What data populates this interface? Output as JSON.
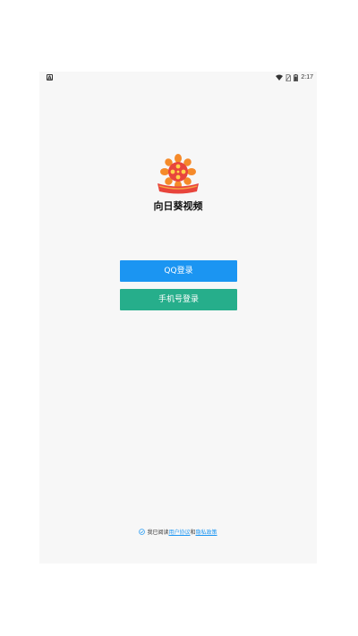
{
  "status_bar": {
    "notification_icon": "A",
    "time": "2:17",
    "icons": [
      "wifi-icon",
      "no-sim-icon",
      "battery-icon"
    ]
  },
  "app": {
    "name": "向日葵视频",
    "logo_icon": "sunflower-logo-icon"
  },
  "buttons": {
    "qq_login": "QQ登录",
    "phone_login": "手机号登录"
  },
  "agreement": {
    "prefix": "我已阅读",
    "user_agreement": "用户协议",
    "and": "和",
    "privacy_policy": "隐私政策"
  },
  "colors": {
    "qq_button": "#1b95f2",
    "phone_button": "#26ae8b",
    "background": "#f7f7f7"
  }
}
